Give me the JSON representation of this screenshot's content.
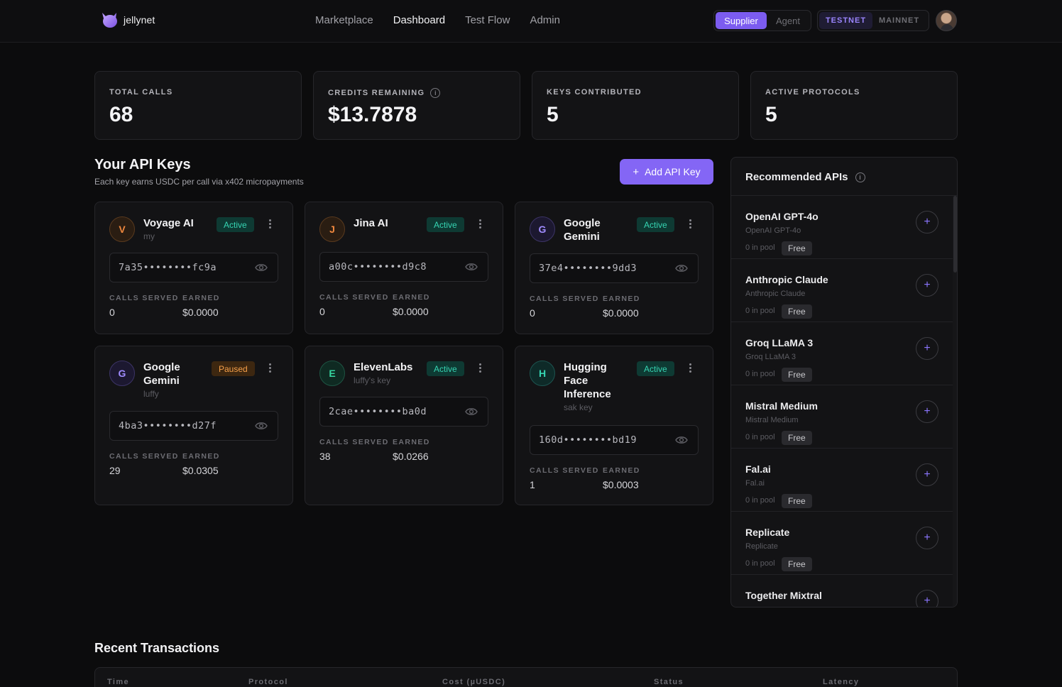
{
  "brand": {
    "name": "jellynet"
  },
  "nav": {
    "links": [
      "Marketplace",
      "Dashboard",
      "Test Flow",
      "Admin"
    ],
    "active": "Dashboard"
  },
  "role_toggle": {
    "options": [
      "Supplier",
      "Agent"
    ],
    "selected": "Supplier"
  },
  "network_toggle": {
    "options": [
      "TESTNET",
      "MAINNET"
    ],
    "selected": "TESTNET"
  },
  "stats": [
    {
      "label": "TOTAL CALLS",
      "value": "68",
      "info": false
    },
    {
      "label": "CREDITS REMAINING",
      "value": "$13.7878",
      "info": true
    },
    {
      "label": "KEYS CONTRIBUTED",
      "value": "5",
      "info": false
    },
    {
      "label": "ACTIVE PROTOCOLS",
      "value": "5",
      "info": false
    }
  ],
  "api_keys": {
    "title": "Your API Keys",
    "subtitle": "Each key earns USDC per call via x402 micropayments",
    "add_label": "Add API Key",
    "calls_label": "CALLS SERVED",
    "earned_label": "EARNED",
    "keys": [
      {
        "initial": "V",
        "name": "Voyage AI",
        "note": "my",
        "status": "Active",
        "key": "7a35••••••••fc9a",
        "calls": "0",
        "earned": "$0.0000",
        "accent": "#f0883e"
      },
      {
        "initial": "J",
        "name": "Jina AI",
        "note": "",
        "status": "Active",
        "key": "a00c••••••••d9c8",
        "calls": "0",
        "earned": "$0.0000",
        "accent": "#f0883e"
      },
      {
        "initial": "G",
        "name": "Google Gemini",
        "note": "",
        "status": "Active",
        "key": "37e4••••••••9dd3",
        "calls": "0",
        "earned": "$0.0000",
        "accent": "#a08cff"
      },
      {
        "initial": "G",
        "name": "Google Gemini",
        "note": "luffy",
        "status": "Paused",
        "key": "4ba3••••••••d27f",
        "calls": "29",
        "earned": "$0.0305",
        "accent": "#a08cff"
      },
      {
        "initial": "E",
        "name": "ElevenLabs",
        "note": "luffy's key",
        "status": "Active",
        "key": "2cae••••••••ba0d",
        "calls": "38",
        "earned": "$0.0266",
        "accent": "#36d5a0"
      },
      {
        "initial": "H",
        "name": "Hugging Face Inference",
        "note": "sak key",
        "status": "Active",
        "key": "160d••••••••bd19",
        "calls": "1",
        "earned": "$0.0003",
        "accent": "#36d5b3"
      }
    ]
  },
  "recommended": {
    "title": "Recommended APIs",
    "items": [
      {
        "name": "OpenAI GPT-4o",
        "provider": "OpenAI GPT-4o",
        "pool": "0 in pool",
        "price": "Free"
      },
      {
        "name": "Anthropic Claude",
        "provider": "Anthropic Claude",
        "pool": "0 in pool",
        "price": "Free"
      },
      {
        "name": "Groq LLaMA 3",
        "provider": "Groq LLaMA 3",
        "pool": "0 in pool",
        "price": "Free"
      },
      {
        "name": "Mistral Medium",
        "provider": "Mistral Medium",
        "pool": "0 in pool",
        "price": "Free"
      },
      {
        "name": "Fal.ai",
        "provider": "Fal.ai",
        "pool": "0 in pool",
        "price": "Free"
      },
      {
        "name": "Replicate",
        "provider": "Replicate",
        "pool": "0 in pool",
        "price": "Free"
      },
      {
        "name": "Together Mixtral",
        "provider": "",
        "pool": "",
        "price": ""
      }
    ]
  },
  "transactions": {
    "title": "Recent Transactions",
    "columns": [
      "Time",
      "Protocol",
      "Cost (µUSDC)",
      "Status",
      "Latency"
    ]
  },
  "colors": {
    "accent": "#8466f5",
    "active": "#36d5b3",
    "paused": "#f6a04a"
  }
}
